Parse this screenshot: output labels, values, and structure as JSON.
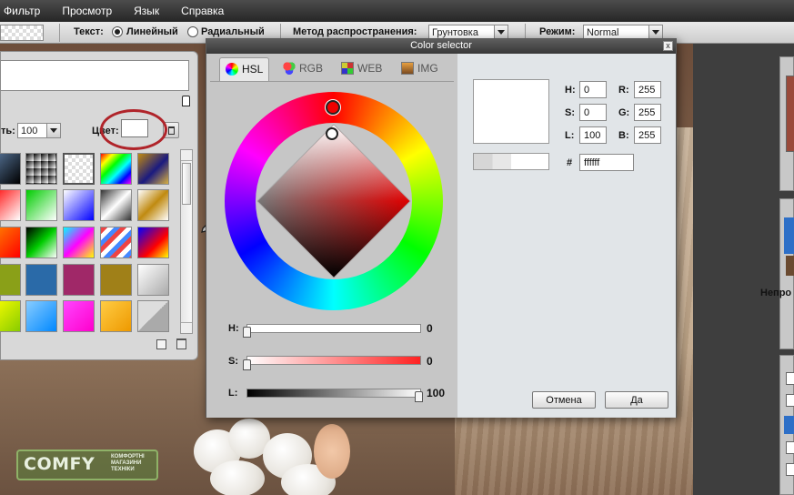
{
  "menubar": {
    "items": [
      "Фильтр",
      "Просмотр",
      "Язык",
      "Справка"
    ]
  },
  "toolbar": {
    "text_label": "Текст:",
    "linear_label": "Линейный",
    "radial_label": "Радиальный",
    "method_label": "Метод распространения:",
    "method_value": "Грунтовка",
    "mode_label": "Режим:",
    "mode_value": "Normal"
  },
  "gradient_panel": {
    "opacity_label": "ть:",
    "opacity_value": "100",
    "color_label": "Цвет:"
  },
  "dialog": {
    "title": "Color selector",
    "close": "x",
    "tabs": [
      {
        "label": "HSL",
        "icon": "hsl-wheel-icon"
      },
      {
        "label": "RGB",
        "icon": "rgb-circles-icon"
      },
      {
        "label": "WEB",
        "icon": "web-grid-icon"
      },
      {
        "label": "IMG",
        "icon": "image-icon"
      }
    ],
    "sliders": {
      "h": {
        "label": "H:",
        "value": "0",
        "fraction": 0.0
      },
      "s": {
        "label": "S:",
        "value": "0",
        "fraction": 0.0
      },
      "l": {
        "label": "L:",
        "value": "100",
        "fraction": 1.0
      }
    },
    "fields": {
      "h_label": "H:",
      "h": "0",
      "s_label": "S:",
      "s": "0",
      "l_label": "L:",
      "l": "100",
      "r_label": "R:",
      "r": "255",
      "g_label": "G:",
      "g": "255",
      "b_label": "B:",
      "b": "255",
      "hex_label": "#",
      "hex": "ffffff"
    },
    "cancel": "Отмена",
    "ok": "Да",
    "current_color": "#ffffff"
  },
  "right_panel": {
    "label": "Непро"
  },
  "watermark": {
    "logo": "COMFY",
    "tagline": "КОМФОРТНІ МАГАЗИНИ ТЕХНІКИ"
  },
  "colors": {
    "highlight_circle": "#b0242a",
    "menubar": "#333333",
    "comfy_green": "#6a9a3a"
  }
}
